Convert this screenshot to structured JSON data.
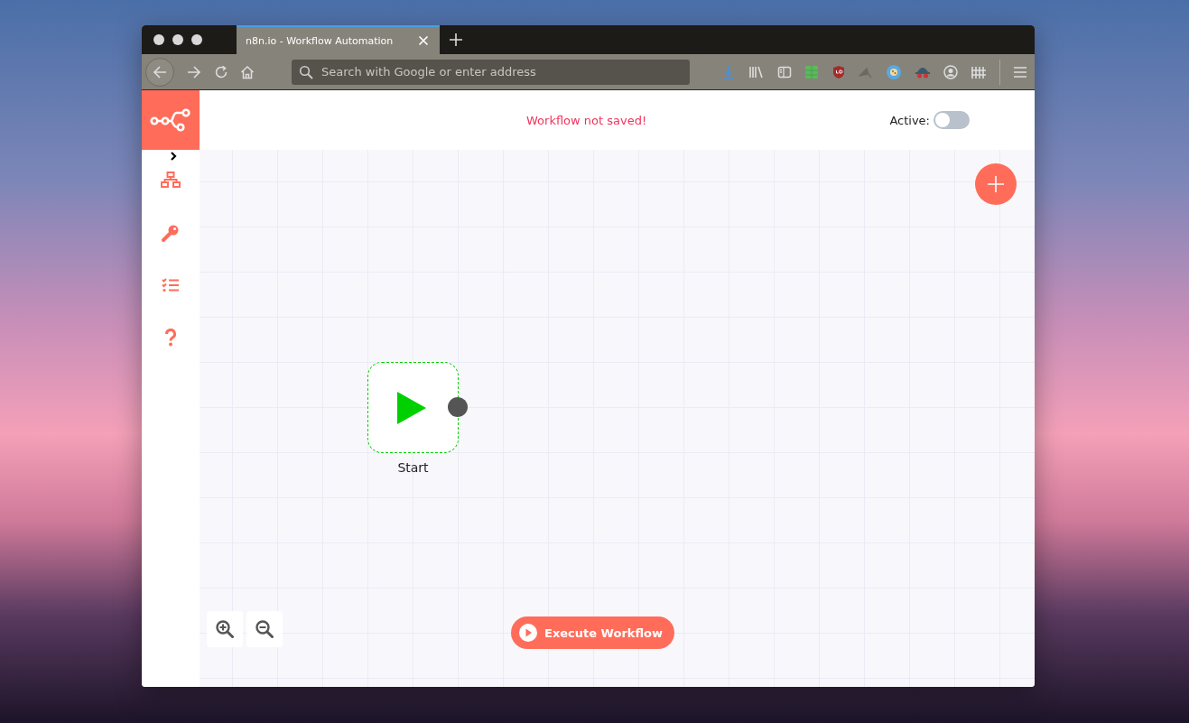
{
  "browser": {
    "tabs": [
      {
        "title": "n8n.io - Workflow Automation",
        "selected": true
      }
    ],
    "address_bar": {
      "placeholder": "Search with Google or enter address"
    }
  },
  "header": {
    "status": "Workflow not saved!",
    "active_label": "Active:",
    "active": false
  },
  "canvas": {
    "nodes": [
      {
        "label": "Start",
        "kind": "trigger"
      }
    ]
  },
  "execute_button": {
    "label": "Execute Workflow"
  }
}
